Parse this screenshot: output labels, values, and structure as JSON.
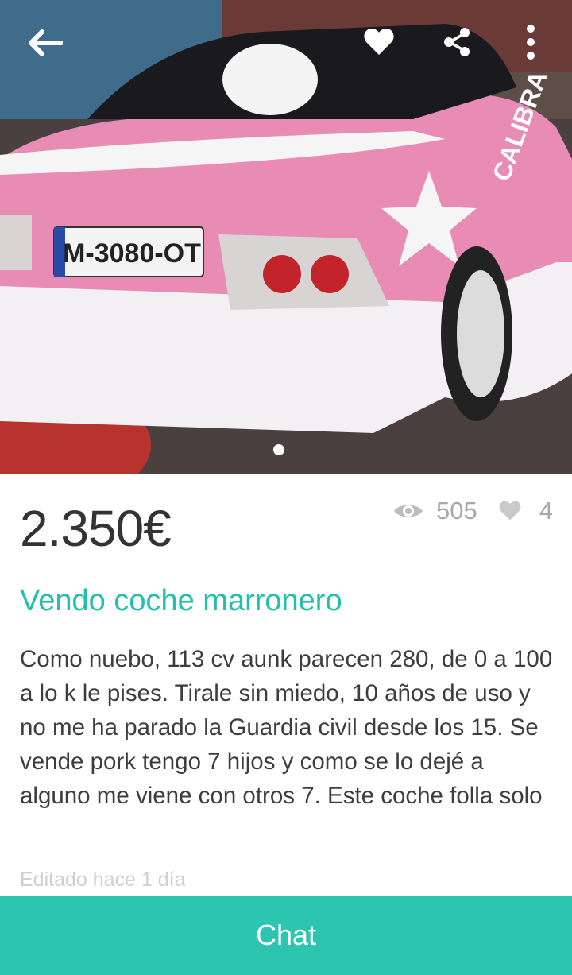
{
  "header": {
    "back_icon": "arrow-left-icon",
    "favorite_icon": "heart-icon",
    "share_icon": "share-icon",
    "more_icon": "more-vertical-icon"
  },
  "photo": {
    "plate_text": "M-3080-OT",
    "car_text": "CALIBRA",
    "pager": {
      "count": 1,
      "active": 0
    }
  },
  "listing": {
    "price": "2.350€",
    "views": "505",
    "likes": "4",
    "title": "Vendo coche marronero",
    "description": "Como nuebo, 113 cv aunk parecen 280, de 0 a 100 a lo k le pises. Tirale sin miedo, 10 años de uso y no me ha parado la Guardia civil desde los 15. Se vende pork tengo 7 hijos y como se lo dejé a alguno me viene con otros 7. Este coche folla solo",
    "edited": "Editado hace 1 día"
  },
  "footer": {
    "chat_label": "Chat"
  },
  "colors": {
    "accent": "#2cc6b0",
    "title": "#22bfab",
    "price": "#333333",
    "muted": "#a9a9a9"
  }
}
